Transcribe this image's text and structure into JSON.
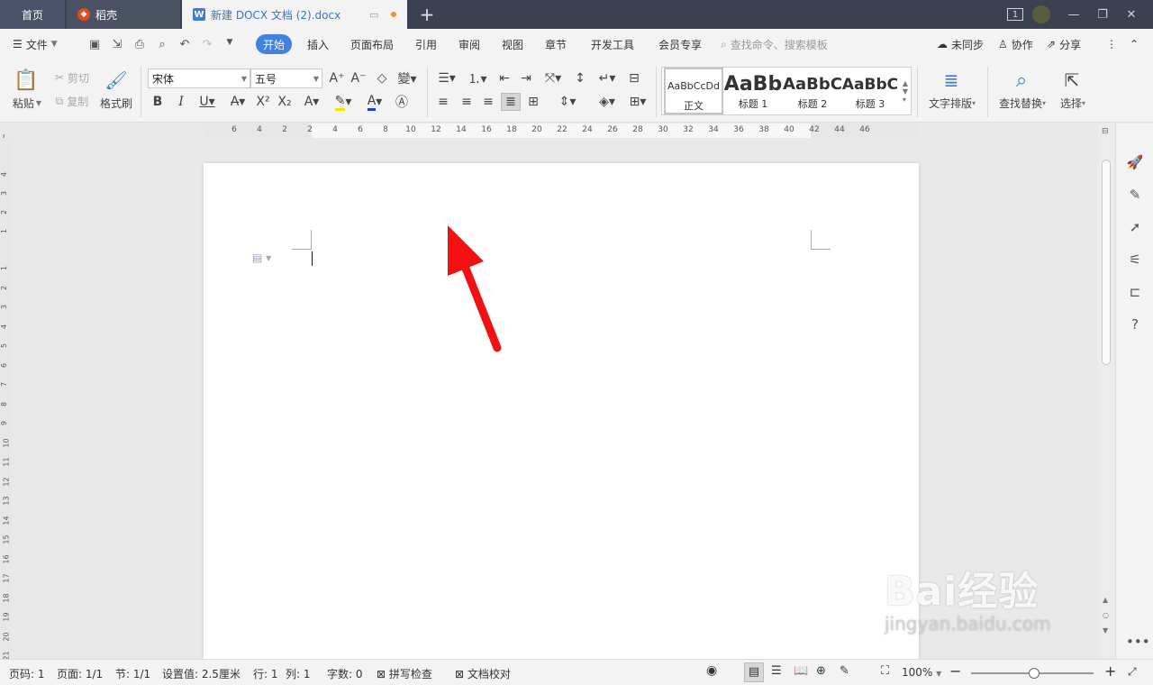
{
  "tabs": {
    "home": "首页",
    "daoke": "稻壳",
    "doc": "新建 DOCX 文档 (2).docx",
    "add": "+"
  },
  "window": {
    "badge": "1"
  },
  "menu": {
    "file": "文件",
    "tabs": [
      "开始",
      "插入",
      "页面布局",
      "引用",
      "审阅",
      "视图",
      "章节",
      "开发工具",
      "会员专享"
    ],
    "search_placeholder": "查找命令、搜索模板",
    "sync": "未同步",
    "collab": "协作",
    "share": "分享"
  },
  "ribbon": {
    "paste": "粘贴",
    "cut": "剪切",
    "copy": "复制",
    "format_painter": "格式刷",
    "font_name": "宋体",
    "font_size": "五号",
    "styles": [
      {
        "sample": "AaBbCcDd",
        "label": "正文"
      },
      {
        "sample": "AaBb",
        "label": "标题 1"
      },
      {
        "sample": "AaBbC",
        "label": "标题 2"
      },
      {
        "sample": "AaBbC",
        "label": "标题 3"
      }
    ],
    "text_layout": "文字排版",
    "find_replace": "查找替换",
    "select": "选择"
  },
  "ruler": {
    "h_ticks": [
      "6",
      "4",
      "2",
      "2",
      "4",
      "6",
      "8",
      "10",
      "12",
      "14",
      "16",
      "18",
      "20",
      "22",
      "24",
      "26",
      "28",
      "30",
      "32",
      "34",
      "36",
      "38",
      "40",
      "42",
      "44",
      "46"
    ],
    "v_ticks": [
      "4",
      "3",
      "2",
      "1",
      "1",
      "2",
      "3",
      "4",
      "5",
      "6",
      "7",
      "8",
      "9",
      "10",
      "11",
      "12",
      "13",
      "14",
      "15",
      "16",
      "17",
      "18",
      "19",
      "20",
      "21"
    ]
  },
  "status": {
    "page_num": "页码: 1",
    "pages": "页面: 1/1",
    "section": "节: 1/1",
    "setting": "设置值: 2.5厘米",
    "row": "行: 1",
    "col": "列: 1",
    "words": "字数: 0",
    "spell_check": "拼写检查",
    "doc_check": "文档校对",
    "zoom": "100%"
  },
  "watermark": {
    "brand": "Bai经验",
    "url": "jingyan.baidu.com"
  }
}
